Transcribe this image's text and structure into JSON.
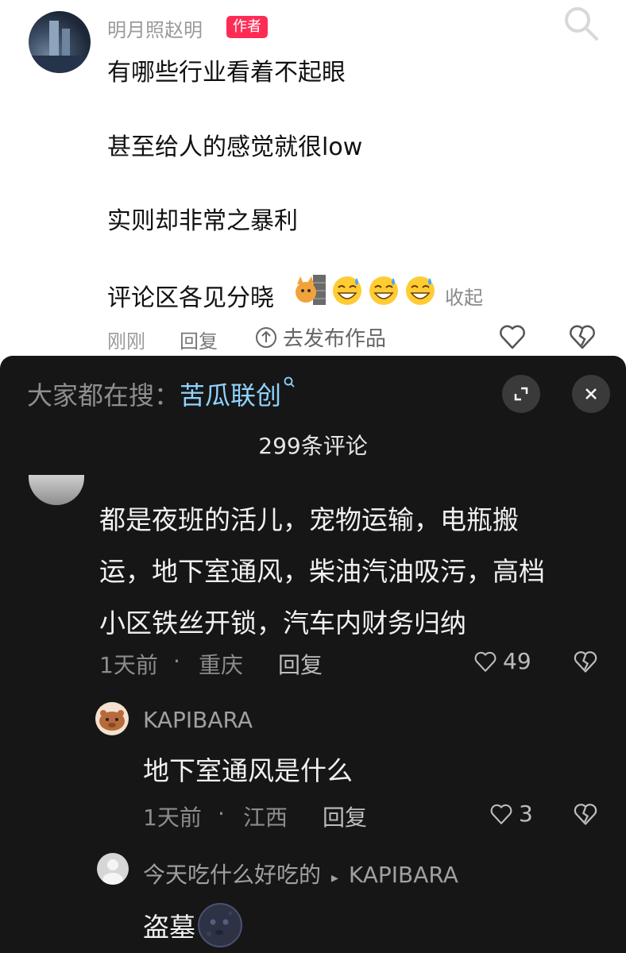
{
  "post": {
    "author": "明月照赵明",
    "badge": "作者",
    "lines": [
      "有哪些行业看着不起眼",
      "甚至给人的感觉就很low",
      "实则却非常之暴利",
      "评论区各见分晓"
    ],
    "emojis": [
      "cat-peek-emoji",
      "laughing-sweat-emoji",
      "laughing-sweat-emoji",
      "laughing-sweat-emoji"
    ],
    "collapse": "收起",
    "time": "刚刚",
    "reply": "回复",
    "publish": "去发布作品"
  },
  "sheet": {
    "search_prefix": "大家都在搜：",
    "search_term": "苦瓜联创",
    "comment_count": "299条评论"
  },
  "comments": [
    {
      "lines": [
        "都是夜班的活儿，宠物运输，电瓶搬",
        "运，地下室通风，柴油汽油吸污，高档",
        "小区铁丝开锁，汽车内财务归纳"
      ],
      "time": "1天前",
      "location": "重庆",
      "reply": "回复",
      "likes": "49"
    }
  ],
  "replies": [
    {
      "name": "KAPIBARA",
      "text": "地下室通风是什么",
      "time": "1天前",
      "location": "江西",
      "reply": "回复",
      "likes": "3"
    },
    {
      "name": "今天吃什么好吃的",
      "arrow": "▸",
      "target": "KAPIBARA",
      "text": "盗墓"
    }
  ],
  "colors": {
    "accent": "#fe2c55",
    "search_term": "#8fd3ff",
    "sheet_bg": "#161616"
  }
}
